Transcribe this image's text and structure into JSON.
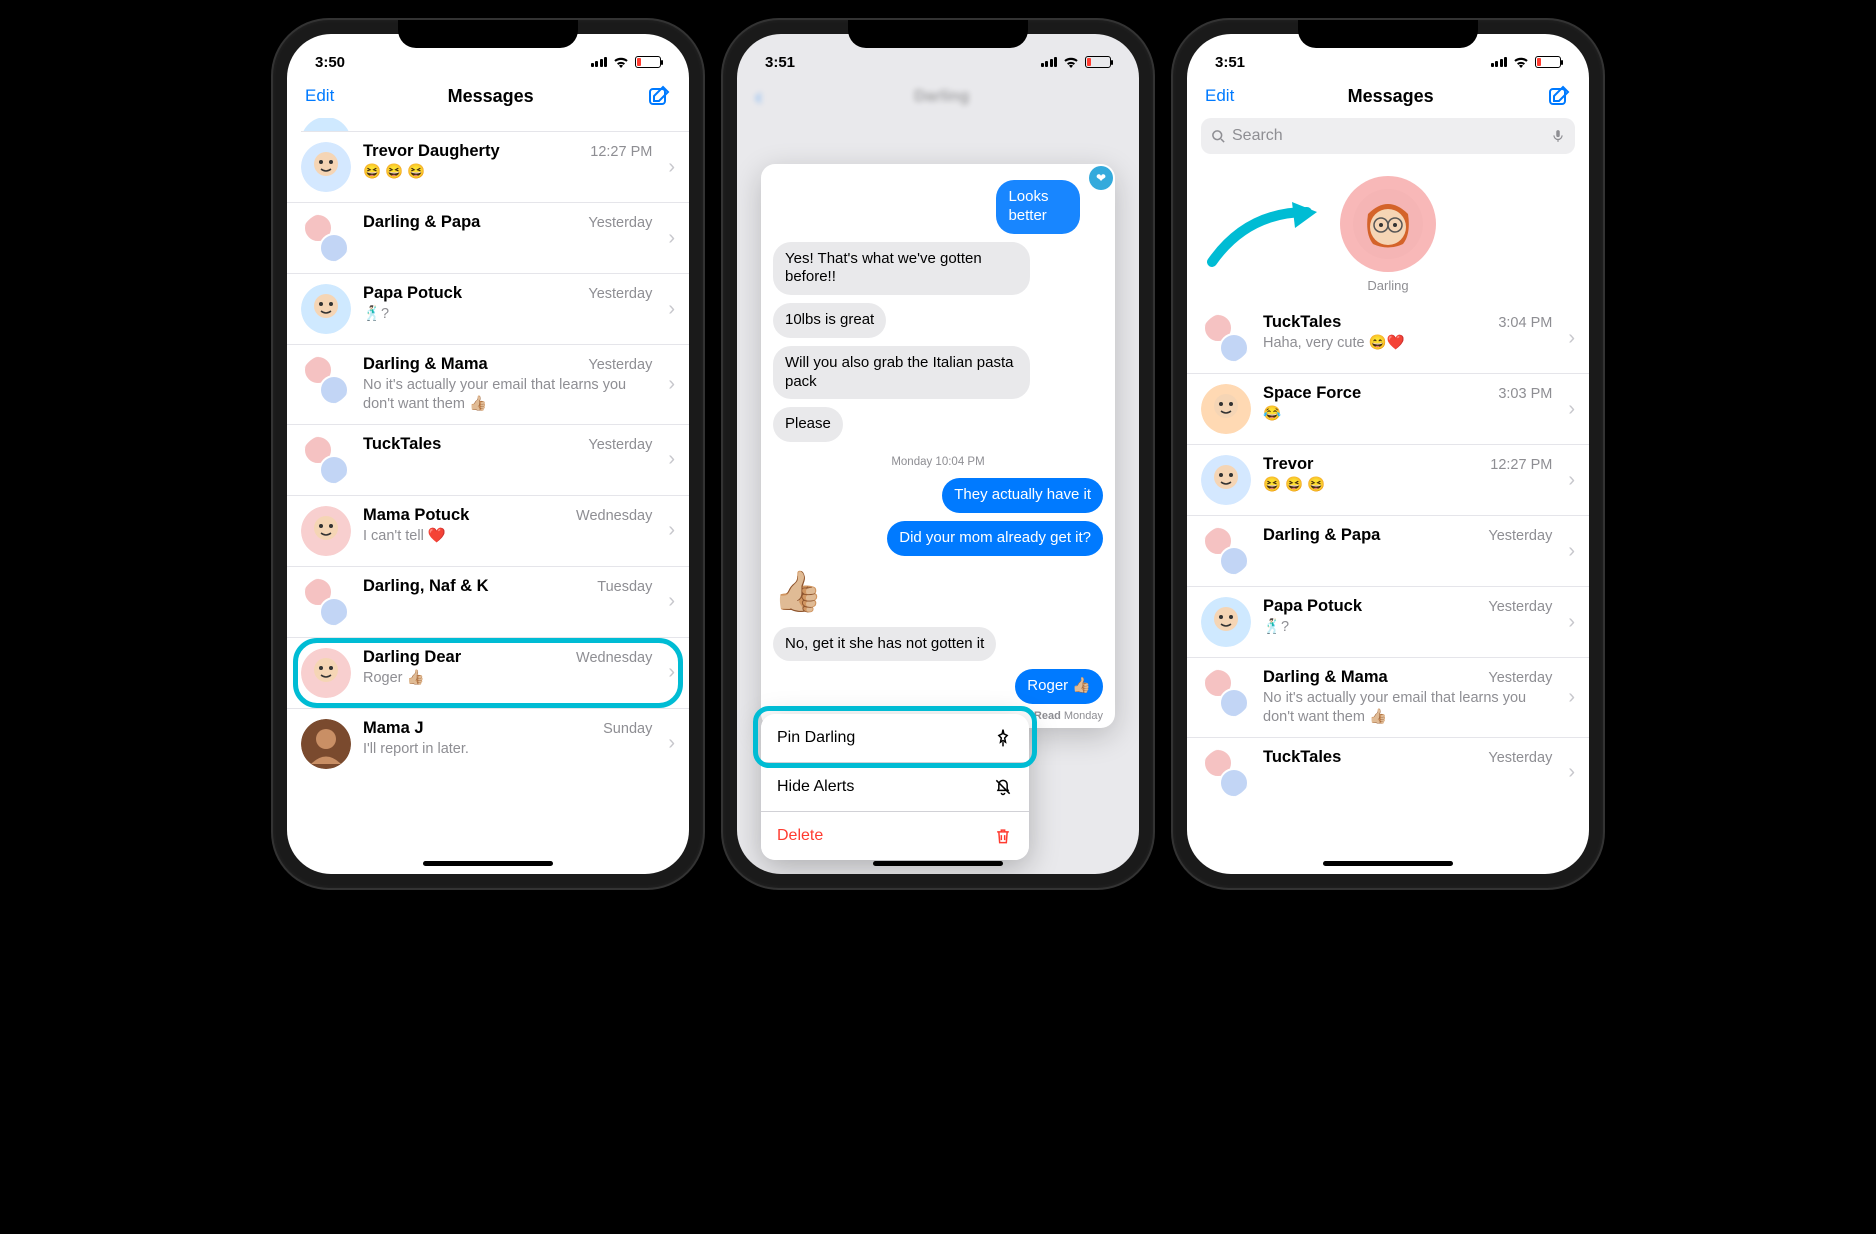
{
  "phone1": {
    "time": "3:50",
    "nav": {
      "edit": "Edit",
      "title": "Messages"
    },
    "conversations": [
      {
        "name": "Trevor Daugherty",
        "time": "12:27 PM",
        "preview": "😆 😆 😆",
        "avatar_bg": "bg-blue"
      },
      {
        "name": "Darling & Papa",
        "time": "Yesterday",
        "preview": "",
        "avatar_bg": "bg-multi"
      },
      {
        "name": "Papa Potuck",
        "time": "Yesterday",
        "preview": "🕺🏻?",
        "avatar_bg": "bg-lightblue"
      },
      {
        "name": "Darling & Mama",
        "time": "Yesterday",
        "preview": "No it's actually your email that learns you don't want them 👍🏼",
        "avatar_bg": "bg-multi"
      },
      {
        "name": "TuckTales",
        "time": "Yesterday",
        "preview": "",
        "avatar_bg": "bg-multi"
      },
      {
        "name": "Mama Potuck",
        "time": "Wednesday",
        "preview": "I can't tell ❤️",
        "avatar_bg": "bg-pink"
      },
      {
        "name": "Darling, Naf & K",
        "time": "Tuesday",
        "preview": "",
        "avatar_bg": "bg-multi"
      },
      {
        "name": "Darling Dear",
        "time": "Wednesday",
        "preview": "Roger 👍🏼",
        "avatar_bg": "bg-pink",
        "highlighted": true
      },
      {
        "name": "Mama J",
        "time": "Sunday",
        "preview": "I'll report in later.",
        "avatar_bg": "bg-photo"
      }
    ]
  },
  "phone2": {
    "time": "3:51",
    "messages": {
      "sent_top": "Looks better",
      "gray1": "Yes! That's what we've gotten before!!",
      "gray2": "10lbs is great",
      "gray3": "Will you also grab the Italian pasta pack",
      "gray4": "Please",
      "timestamp": "Monday 10:04 PM",
      "blue1": "They actually have it",
      "blue2": "Did your mom already get it?",
      "thumb": "👍🏼",
      "gray5": "No, get it she has not gotten it",
      "blue3": "Roger 👍🏼",
      "read_label": "Read",
      "read_time": "Monday"
    },
    "menu": {
      "pin": "Pin Darling",
      "hide": "Hide Alerts",
      "delete": "Delete"
    }
  },
  "phone3": {
    "time": "3:51",
    "nav": {
      "edit": "Edit",
      "title": "Messages"
    },
    "search_placeholder": "Search",
    "pinned": {
      "name": "Darling"
    },
    "conversations": [
      {
        "name": "TuckTales",
        "time": "3:04 PM",
        "preview": "Haha, very cute 😄❤️",
        "avatar_bg": "bg-multi"
      },
      {
        "name": "Space Force",
        "time": "3:03 PM",
        "preview": "😂",
        "avatar_bg": "bg-orange"
      },
      {
        "name": "Trevor",
        "time": "12:27 PM",
        "preview": "😆 😆 😆",
        "avatar_bg": "bg-blue"
      },
      {
        "name": "Darling & Papa",
        "time": "Yesterday",
        "preview": "",
        "avatar_bg": "bg-multi"
      },
      {
        "name": "Papa Potuck",
        "time": "Yesterday",
        "preview": "🕺🏻?",
        "avatar_bg": "bg-lightblue"
      },
      {
        "name": "Darling & Mama",
        "time": "Yesterday",
        "preview": "No it's actually your email that learns you don't want them 👍🏼",
        "avatar_bg": "bg-multi"
      },
      {
        "name": "TuckTales",
        "time": "Yesterday",
        "preview": "",
        "avatar_bg": "bg-multi"
      }
    ]
  }
}
